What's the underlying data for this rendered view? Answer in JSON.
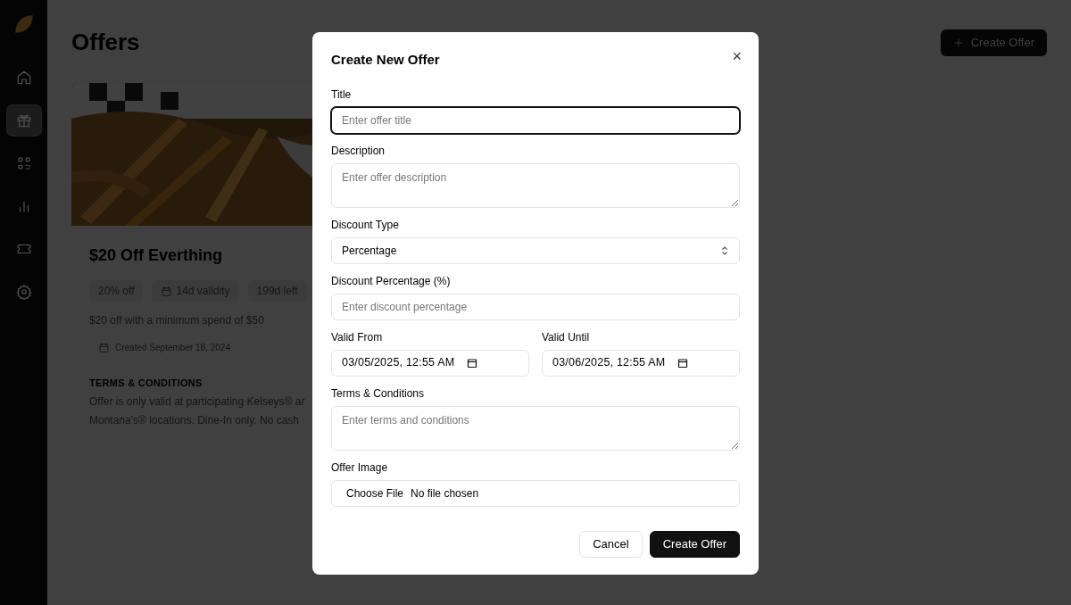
{
  "sidebar": {
    "items": [
      {
        "kind": "home",
        "selected": false
      },
      {
        "kind": "gift",
        "selected": true
      },
      {
        "kind": "qr",
        "selected": false
      },
      {
        "kind": "chart",
        "selected": false
      },
      {
        "kind": "ticket",
        "selected": false
      },
      {
        "kind": "settings",
        "selected": false
      }
    ]
  },
  "page": {
    "title": "Offers",
    "create_button": "Create Offer"
  },
  "offer_card": {
    "image": {
      "kind": "picture"
    },
    "title": "$20 Off Everthing",
    "badges": [
      {
        "kind": "plain",
        "label": "20% off"
      },
      {
        "kind": "calendar",
        "label": "14d validity"
      },
      {
        "kind": "plain",
        "label": "199d left"
      }
    ],
    "description": "$20 off with a minimum spend of $50",
    "created": "Created September 18, 2024",
    "terms_heading": "TERMS & CONDITIONS",
    "terms_lines": [
      "Offer is only valid at participating Kelseys® ar",
      "Montana's® locations. Dine-In only. No cash"
    ]
  },
  "dialog": {
    "title": "Create New Offer",
    "close": "×",
    "fields": [
      {
        "kind": "text",
        "label": "Title",
        "placeholder": "Enter offer title",
        "focused": true
      },
      {
        "kind": "textarea",
        "label": "Description",
        "placeholder": "Enter offer description",
        "focused": false
      },
      {
        "kind": "select",
        "label": "Discount Type",
        "value": "Percentage",
        "focused": false
      },
      {
        "kind": "text",
        "label": "Discount Percentage (%)",
        "placeholder": "Enter discount percentage",
        "focused": false
      },
      {
        "kind": "datetime_pair",
        "items": [
          {
            "label": "Valid From",
            "value": "03/05/2025, 12:55 AM"
          },
          {
            "label": "Valid Until",
            "value": "03/06/2025, 12:55 AM"
          }
        ]
      },
      {
        "kind": "textarea",
        "label": "Terms & Conditions",
        "placeholder": "Enter terms and conditions",
        "focused": false
      },
      {
        "kind": "file",
        "label": "Offer Image",
        "button": "Choose File",
        "value": "No file chosen"
      }
    ],
    "buttons": [
      {
        "kind": "secondary",
        "label": "Cancel"
      },
      {
        "kind": "primary",
        "label": "Create Offer"
      }
    ]
  }
}
